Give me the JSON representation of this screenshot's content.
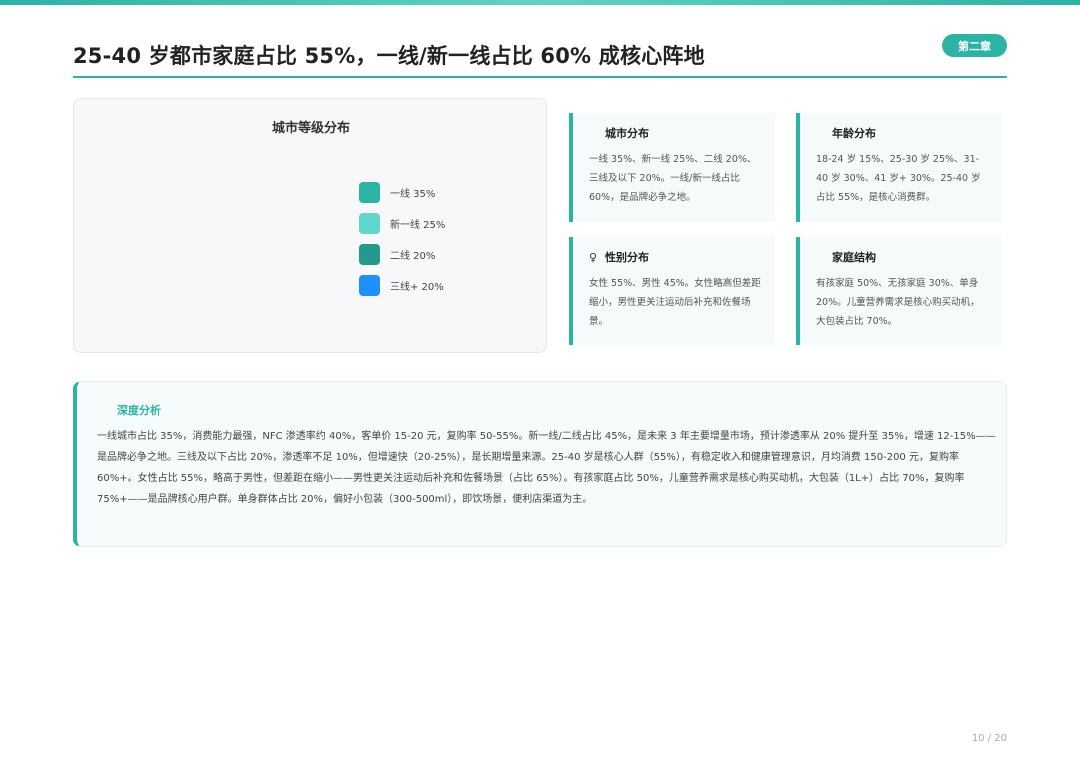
{
  "header": {
    "title": "25-40 岁都市家庭占比 55%，一线/新一线占比 60% 成核心阵地",
    "badge": "第二章"
  },
  "chart": {
    "title": "城市等级分布",
    "legend": [
      {
        "label": "一线 35%",
        "color": "#2bb3a3"
      },
      {
        "label": "新一线 25%",
        "color": "#5fd8cb"
      },
      {
        "label": "二线 20%",
        "color": "#25998c"
      },
      {
        "label": "三线+ 20%",
        "color": "#1e90ff"
      }
    ]
  },
  "cards": [
    {
      "icon": "",
      "title": "城市分布",
      "text": "一线 35%、新一线 25%、二线 20%、三线及以下 20%。一线/新一线占比 60%，是品牌必争之地。"
    },
    {
      "icon": "",
      "title": "年龄分布",
      "text": "18-24 岁 15%、25-30 岁 25%、31-40 岁 30%、41 岁+ 30%。25-40 岁占比 55%，是核心消费群。"
    },
    {
      "icon": "♀",
      "title": "性别分布",
      "text": "女性 55%、男性 45%。女性略高但差距缩小，男性更关注运动后补充和佐餐场景。"
    },
    {
      "icon": "",
      "title": "家庭结构",
      "text": "有孩家庭 50%、无孩家庭 30%、单身 20%。儿童营养需求是核心购买动机，大包装占比 70%。"
    }
  ],
  "analysis": {
    "title": "深度分析",
    "text": "一线城市占比 35%，消费能力最强，NFC 渗透率约 40%，客单价 15-20 元，复购率 50-55%。新一线/二线占比 45%，是未来 3 年主要增量市场，预计渗透率从 20% 提升至 35%，增速 12-15%——是品牌必争之地。三线及以下占比 20%，渗透率不足 10%，但增速快（20-25%），是长期增量来源。25-40 岁是核心人群（55%），有稳定收入和健康管理意识，月均消费 150-200 元，复购率 60%+。女性占比 55%，略高于男性，但差距在缩小——男性更关注运动后补充和佐餐场景（占比 65%）。有孩家庭占比 50%，儿童营养需求是核心购买动机，大包装（1L+）占比 70%，复购率 75%+——是品牌核心用户群。单身群体占比 20%，偏好小包装（300-500ml），即饮场景，便利店渠道为主。"
  },
  "footer": {
    "page": "10 / 20"
  }
}
